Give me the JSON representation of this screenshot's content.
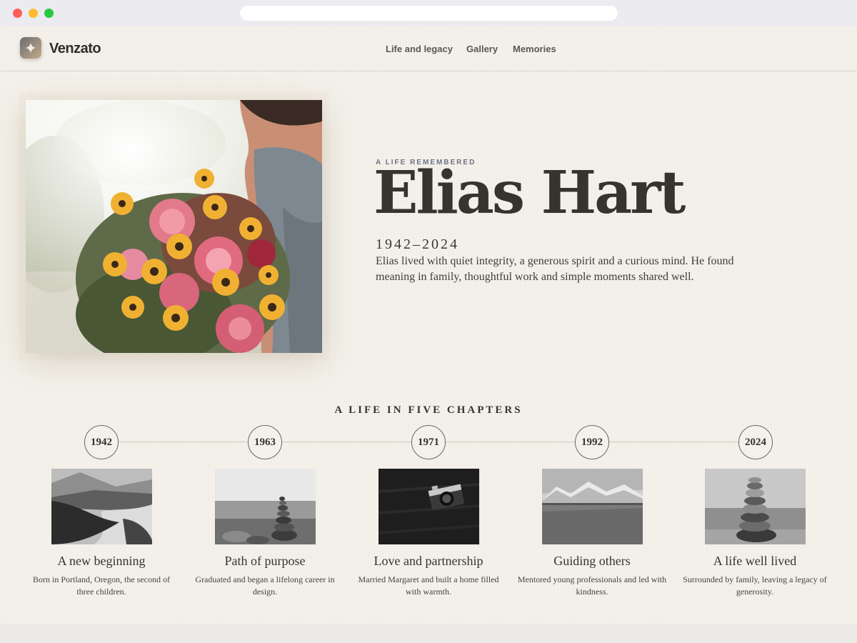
{
  "brand": {
    "name": "Venzato",
    "icon": "sparkle-icon"
  },
  "nav": [
    {
      "label": "Life and legacy"
    },
    {
      "label": "Gallery"
    },
    {
      "label": "Memories"
    }
  ],
  "hero": {
    "eyebrow": "A LIFE REMEMBERED",
    "name": "Elias Hart",
    "dates": "1942–2024",
    "bio": "Elias lived with quiet integrity, a generous spirit and a curious mind. He found meaning in family, thoughtful work and simple moments shared well."
  },
  "timeline": {
    "title": "A LIFE IN FIVE CHAPTERS",
    "chapters": [
      {
        "year": "1942",
        "title": "A new beginning",
        "desc": "Born in Portland, Oregon, the second of three children."
      },
      {
        "year": "1963",
        "title": "Path of purpose",
        "desc": "Graduated and began a lifelong career in design."
      },
      {
        "year": "1971",
        "title": "Love and partnership",
        "desc": "Married Margaret and built a home filled with warmth."
      },
      {
        "year": "1992",
        "title": "Guiding others",
        "desc": "Mentored young professionals and led with kindness."
      },
      {
        "year": "2024",
        "title": "A life well lived",
        "desc": "Surrounded by family, leaving a legacy of generosity."
      }
    ]
  },
  "colors": {
    "page_bg": "#f4f1ea",
    "text_dark": "#35342f",
    "eyebrow": "#6d7286"
  }
}
